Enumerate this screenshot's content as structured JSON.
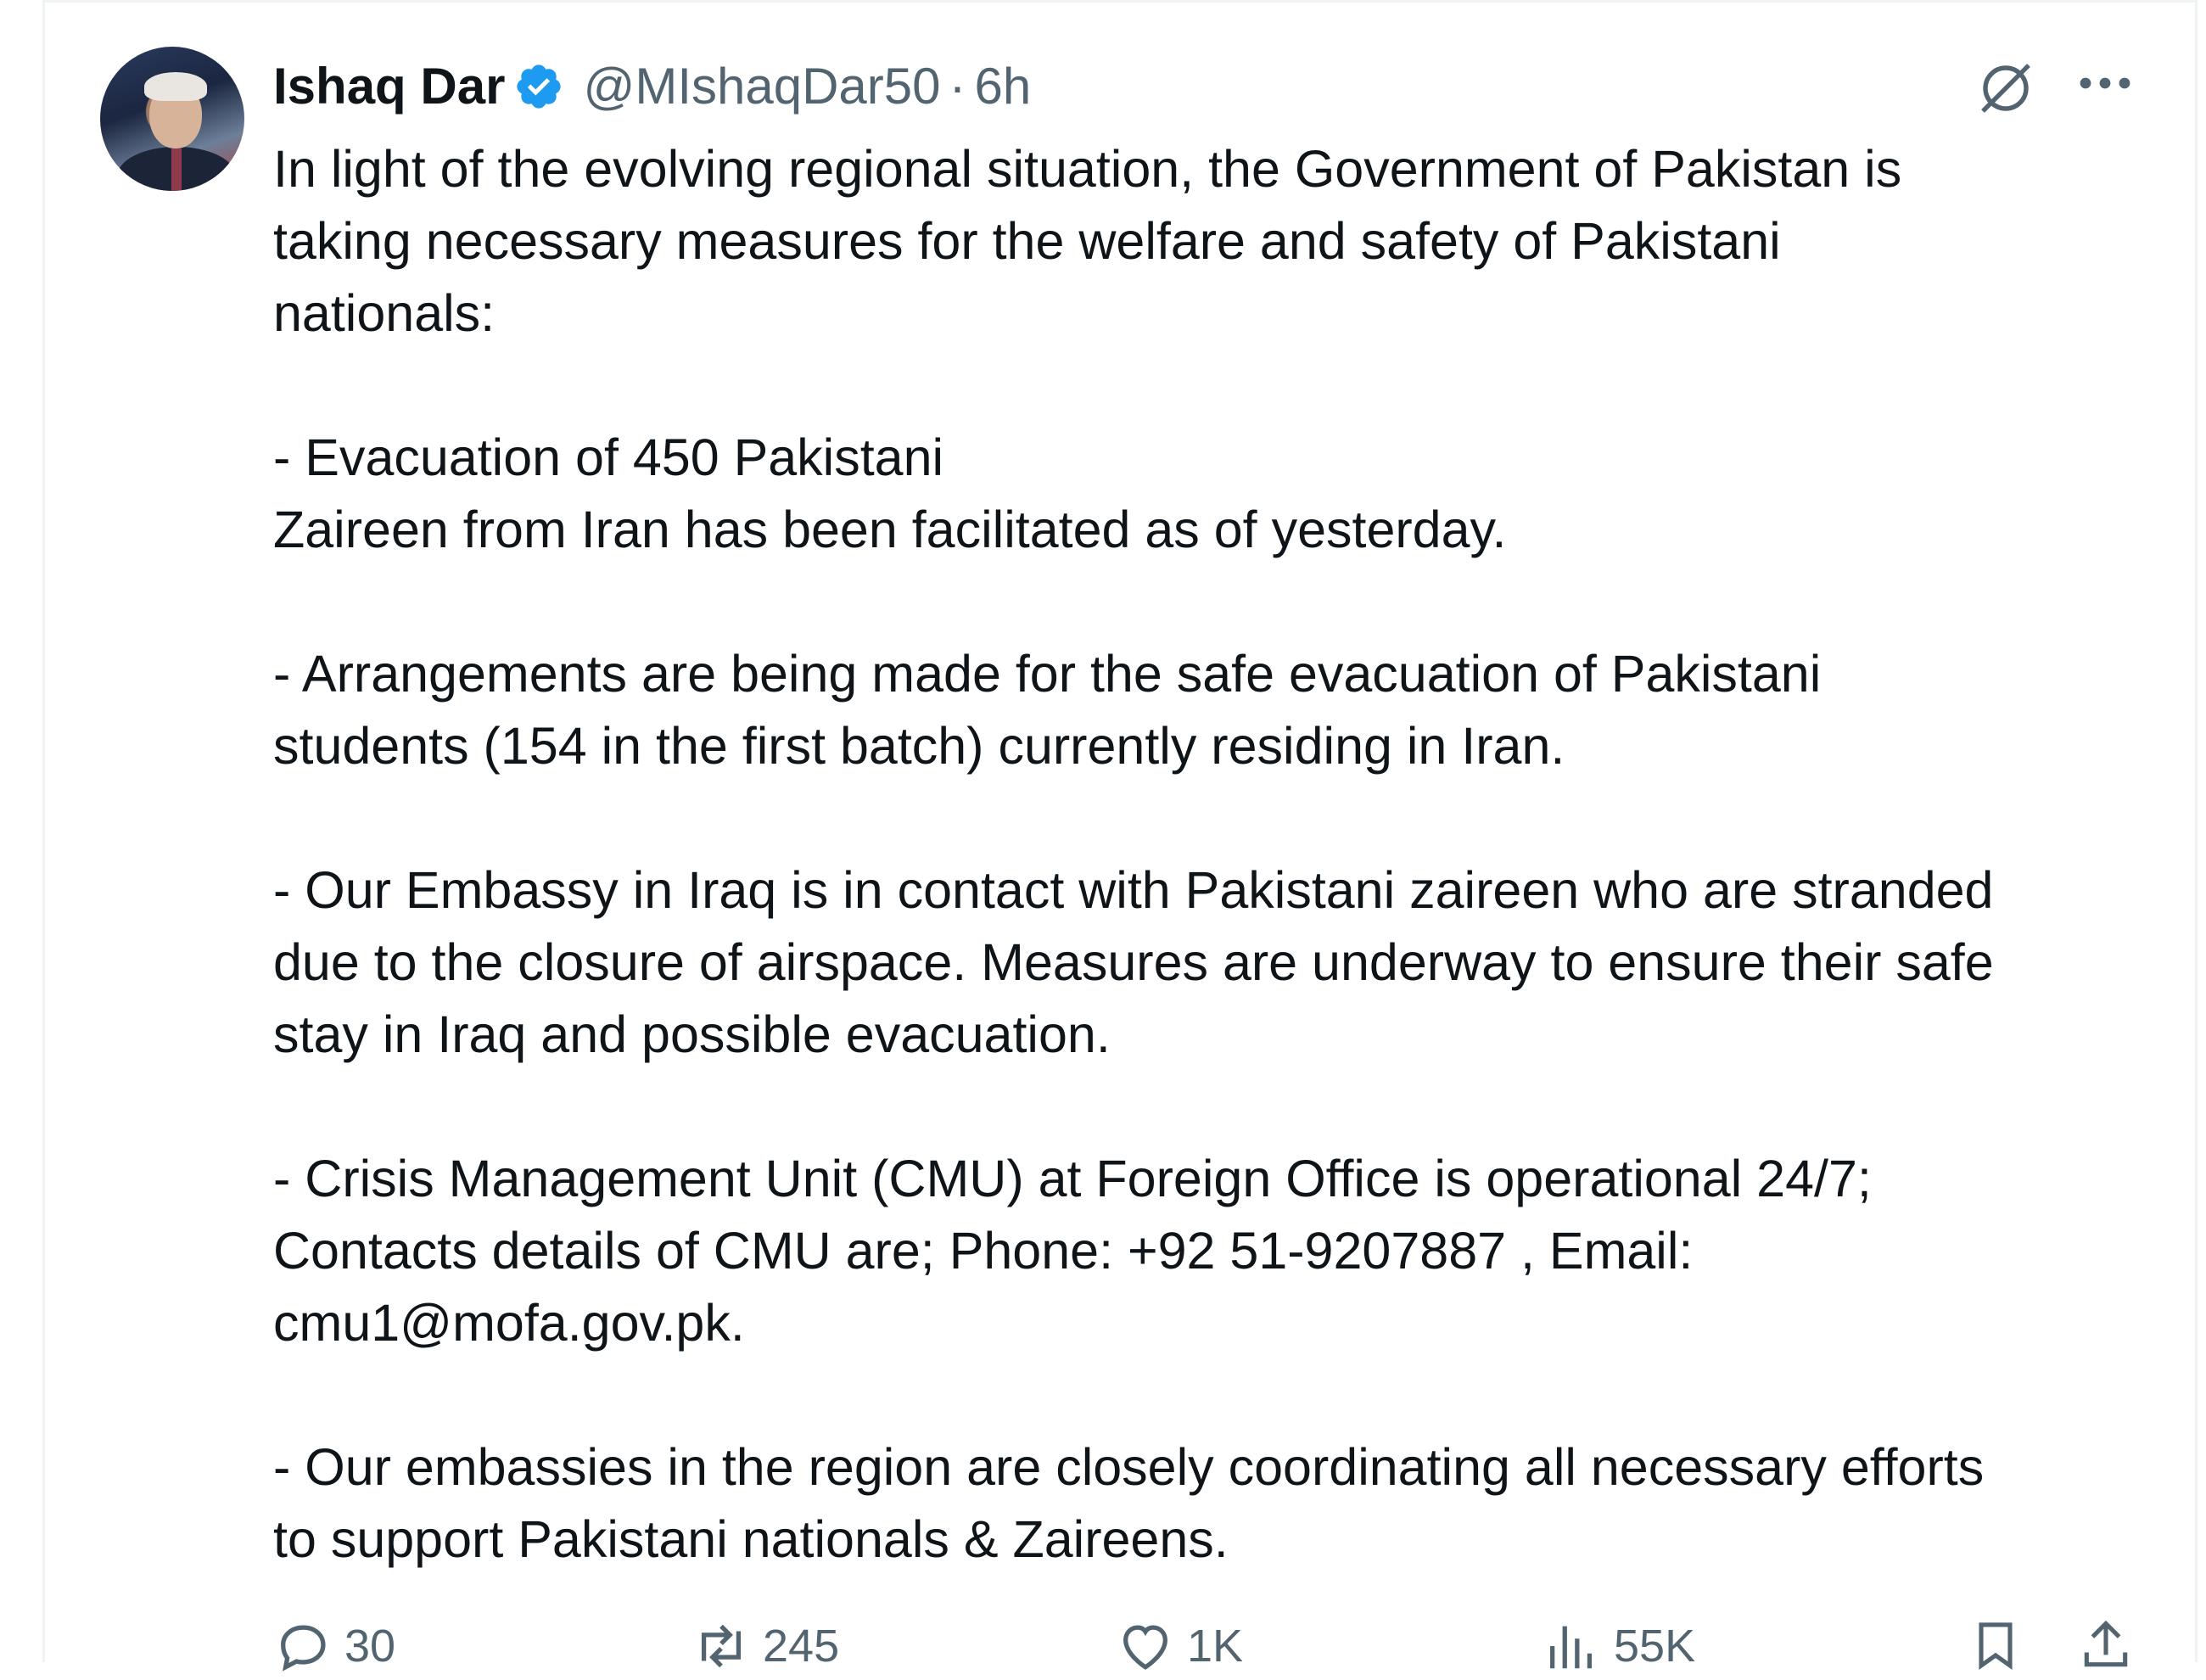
{
  "author": {
    "name": "Ishaq Dar",
    "handle": "@MIshaqDar50",
    "separator": "·",
    "time": "6h",
    "verified": true
  },
  "tweet": {
    "lines": [
      "In light of the evolving regional situation, the Government of Pakistan is",
      "taking necessary measures for the welfare and safety of Pakistani",
      "nationals:",
      "",
      "- Evacuation of 450 Pakistani",
      "Zaireen from Iran has been facilitated as of yesterday.",
      "",
      "- Arrangements are being made for the safe evacuation of Pakistani",
      "students (154 in the first batch) currently residing in Iran.",
      "",
      "- Our Embassy in Iraq is in contact with Pakistani zaireen who are stranded",
      "due to the closure of airspace. Measures are underway to ensure their safe",
      "stay in Iraq and possible evacuation.",
      "",
      "- Crisis Management Unit (CMU) at Foreign Office is operational 24/7;",
      "Contacts details of CMU are; Phone: +92 51-9207887 , Email:",
      "cmu1@mofa.gov.pk.",
      "",
      "- Our embassies in the region are closely coordinating all necessary efforts",
      "to support Pakistani nationals & Zaireens."
    ]
  },
  "actions": {
    "replies": "30",
    "reposts": "245",
    "likes": "1K",
    "views": "55K"
  },
  "icons": {
    "verified": "verified-badge-icon",
    "grok": "grok-icon",
    "more": "more-icon",
    "reply": "reply-icon",
    "repost": "repost-icon",
    "like": "like-icon",
    "views": "views-icon",
    "bookmark": "bookmark-icon",
    "share": "share-icon"
  },
  "colors": {
    "text": "#0f1419",
    "muted": "#536471",
    "verified": "#1d9bf0",
    "border": "#eff3f4"
  }
}
